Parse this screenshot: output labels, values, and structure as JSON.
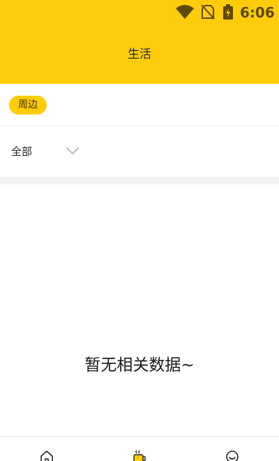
{
  "status_bar": {
    "time": "6:06",
    "icons": [
      "wifi-icon",
      "no-sim-icon",
      "battery-charging-icon"
    ]
  },
  "header": {
    "title": "生活"
  },
  "categories": {
    "items": [
      {
        "label": "周边",
        "selected": true
      }
    ]
  },
  "filter": {
    "selected_label": "全部",
    "icon": "chevron-down-icon"
  },
  "empty_state": {
    "message": "暂无相关数据~"
  },
  "bottom_nav": {
    "items": [
      {
        "icon": "home-icon"
      },
      {
        "icon": "cup-icon",
        "active": true
      },
      {
        "icon": "smile-icon"
      }
    ]
  },
  "colors": {
    "brand": "#FECC0A",
    "divider": "#f3f3f3",
    "text": "#222222"
  }
}
